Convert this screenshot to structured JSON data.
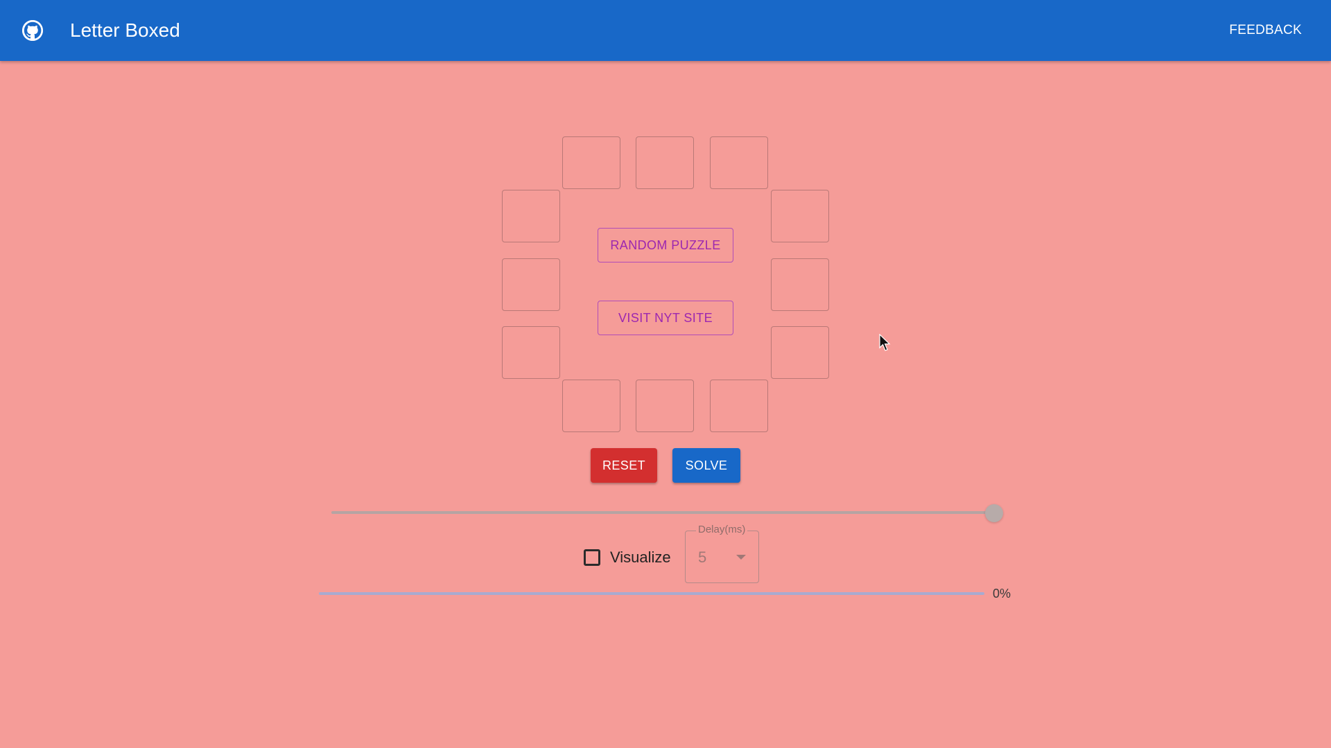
{
  "header": {
    "title": "Letter Boxed",
    "feedback_label": "FEEDBACK",
    "icon": "github-icon"
  },
  "puzzle": {
    "letters": [
      "",
      "",
      "",
      "",
      "",
      "",
      "",
      "",
      "",
      "",
      "",
      ""
    ],
    "random_puzzle_label": "RANDOM PUZZLE",
    "visit_nyt_label": "VISIT NYT SITE"
  },
  "controls": {
    "reset_label": "RESET",
    "solve_label": "SOLVE",
    "slider_value": 1.0,
    "visualize_label": "Visualize",
    "visualize_checked": false,
    "delay_label": "Delay(ms)",
    "delay_value": "5"
  },
  "progress": {
    "percent": 0,
    "text": "0%"
  },
  "colors": {
    "app_bar": "#1868c8",
    "background": "#f59c98",
    "reset_button": "#d32f2f",
    "solve_button": "#1868c8",
    "outline_button": "#9c27b0"
  }
}
